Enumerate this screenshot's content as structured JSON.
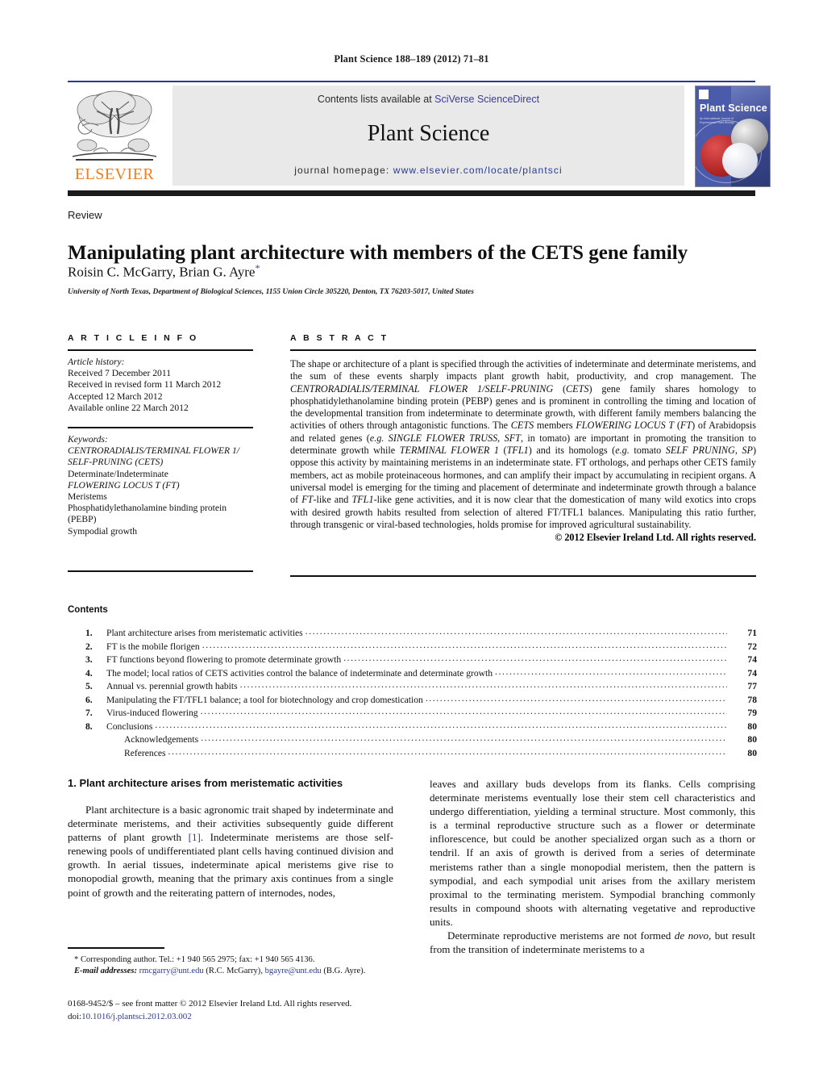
{
  "running_head": "Plant Science 188–189 (2012) 71–81",
  "masthead": {
    "publisher_wordmark": "ELSEVIER",
    "contents_line": "Contents lists available at ",
    "contents_link": "SciVerse ScienceDirect",
    "journal_title": "Plant Science",
    "homepage_label": "journal homepage: ",
    "homepage_url": "www.elsevier.com/locate/plantsci",
    "cover_title": "Plant Science",
    "cover_subtitle": "An International Journal of Experimental Plant Biology"
  },
  "article": {
    "kicker": "Review",
    "title": "Manipulating plant architecture with members of the CETS gene family",
    "authors": "Roisin C. McGarry, Brian G. Ayre",
    "corresponding_marker": "*",
    "affiliation": "University of North Texas, Department of Biological Sciences, 1155 Union Circle 305220, Denton, TX 76203-5017, United States"
  },
  "article_info": {
    "heading": "A R T I C L E   I N F O",
    "history_label": "Article history:",
    "history": [
      "Received 7 December 2011",
      "Received in revised form 11 March 2012",
      "Accepted 12 March 2012",
      "Available online 22 March 2012"
    ],
    "keywords_label": "Keywords:",
    "keywords": [
      "CENTRORADIALIS/TERMINAL FLOWER 1/",
      "SELF-PRUNING (CETS)",
      "Determinate/Indeterminate",
      "FLOWERING LOCUS T (FT)",
      "Meristems",
      "Phosphatidylethanolamine binding protein",
      "(PEBP)",
      "Sympodial growth"
    ]
  },
  "abstract": {
    "heading": "A B S T R A C T",
    "text_html": "The shape or architecture of a plant is specified through the activities of indeterminate and determinate meristems, and the sum of these events sharply impacts plant growth habit, productivity, and crop management. The <i>CENTRORADIALIS/TERMINAL FLOWER 1/SELF-PRUNING</i> (<i>CETS</i>) gene family shares homology to phosphatidylethanolamine binding protein (PEBP) genes and is prominent in controlling the timing and location of the developmental transition from indeterminate to determinate growth, with different family members balancing the activities of others through antagonistic functions. The <i>CETS</i> members <i>FLOWERING LOCUS T</i> (<i>FT</i>) of Arabidopsis and related genes (<i>e.g. SINGLE FLOWER TRUSS, SFT</i>, in tomato) are important in promoting the transition to determinate growth while <i>TERMINAL FLOWER 1</i> (<i>TFL1</i>) and its homologs (<i>e.g.</i> tomato <i>SELF PRUNING, SP</i>) oppose this activity by maintaining meristems in an indeterminate state. FT orthologs, and perhaps other CETS family members, act as mobile proteinaceous hormones, and can amplify their impact by accumulating in recipient organs. A universal model is emerging for the timing and placement of determinate and indeterminate growth through a balance of <i>FT</i>-like and <i>TFL1</i>-like gene activities, and it is now clear that the domestication of many wild exotics into crops with desired growth habits resulted from selection of altered FT/TFL1 balances. Manipulating this ratio further, through transgenic or viral-based technologies, holds promise for improved agricultural sustainability.",
    "copyright": "© 2012 Elsevier Ireland Ltd. All rights reserved."
  },
  "contents": {
    "heading": "Contents",
    "items": [
      {
        "num": "1.",
        "label": "Plant architecture arises from meristematic activities",
        "page": "71",
        "sub": false
      },
      {
        "num": "2.",
        "label": "FT is the mobile florigen",
        "page": "72",
        "sub": false
      },
      {
        "num": "3.",
        "label": "FT functions beyond flowering to promote determinate growth",
        "page": "74",
        "sub": false
      },
      {
        "num": "4.",
        "label": "The model; local ratios of CETS activities control the balance of indeterminate and determinate growth",
        "page": "74",
        "sub": false
      },
      {
        "num": "5.",
        "label": "Annual vs. perennial growth habits",
        "page": "77",
        "sub": false
      },
      {
        "num": "6.",
        "label": "Manipulating the FT/TFL1 balance; a tool for biotechnology and crop domestication",
        "page": "78",
        "sub": false
      },
      {
        "num": "7.",
        "label": "Virus-induced flowering",
        "page": "79",
        "sub": false
      },
      {
        "num": "8.",
        "label": "Conclusions",
        "page": "80",
        "sub": false
      },
      {
        "num": "",
        "label": "Acknowledgements",
        "page": "80",
        "sub": true
      },
      {
        "num": "",
        "label": "References",
        "page": "80",
        "sub": true
      }
    ]
  },
  "body": {
    "section_heading": "1.  Plant architecture arises from meristematic activities",
    "left_paragraph_html": "Plant architecture is a basic agronomic trait shaped by indeterminate and determinate meristems, and their activities subsequently guide different patterns of plant growth <span class=\"ref-link\">[1]</span>. Indeterminate meristems are those self-renewing pools of undifferentiated plant cells having continued division and growth. In aerial tissues, indeterminate apical meristems give rise to monopodial growth, meaning that the primary axis continues from a single point of growth and the reiterating pattern of internodes, nodes,",
    "right_paragraph_1_html": "leaves and axillary buds develops from its flanks. Cells comprising determinate meristems eventually lose their stem cell characteristics and undergo differentiation, yielding a terminal structure. Most commonly, this is a terminal reproductive structure such as a flower or determinate inflorescence, but could be another specialized organ such as a thorn or tendril. If an axis of growth is derived from a series of determinate meristems rather than a single monopodial meristem, then the pattern is sympodial, and each sympodial unit arises from the axillary meristem proximal to the terminating meristem. Sympodial branching commonly results in compound shoots with alternating vegetative and reproductive units.",
    "right_paragraph_2_html": "Determinate reproductive meristems are not formed <i>de novo</i>, but result from the transition of indeterminate meristems to a"
  },
  "footer": {
    "corresponding_html": "* Corresponding author. Tel.: +1 940 565 2975; fax: +1 940 565 4136.",
    "email_label": "E-mail addresses:",
    "email_1": "rmcgarry@unt.edu",
    "email_1_attrib": "(R.C. McGarry),",
    "email_2": "bgayre@unt.edu",
    "email_2_attrib": "(B.G. Ayre).",
    "issn_line": "0168-9452/$ – see front matter © 2012 Elsevier Ireland Ltd. All rights reserved.",
    "doi_label": "doi:",
    "doi_value": "10.1016/j.plantsci.2012.03.002"
  },
  "colors": {
    "link_blue": "#2b3a8f",
    "elsevier_orange": "#f07d20",
    "rule_dark": "#1b1b1b",
    "masthead_grey": "#e9e9e9"
  }
}
